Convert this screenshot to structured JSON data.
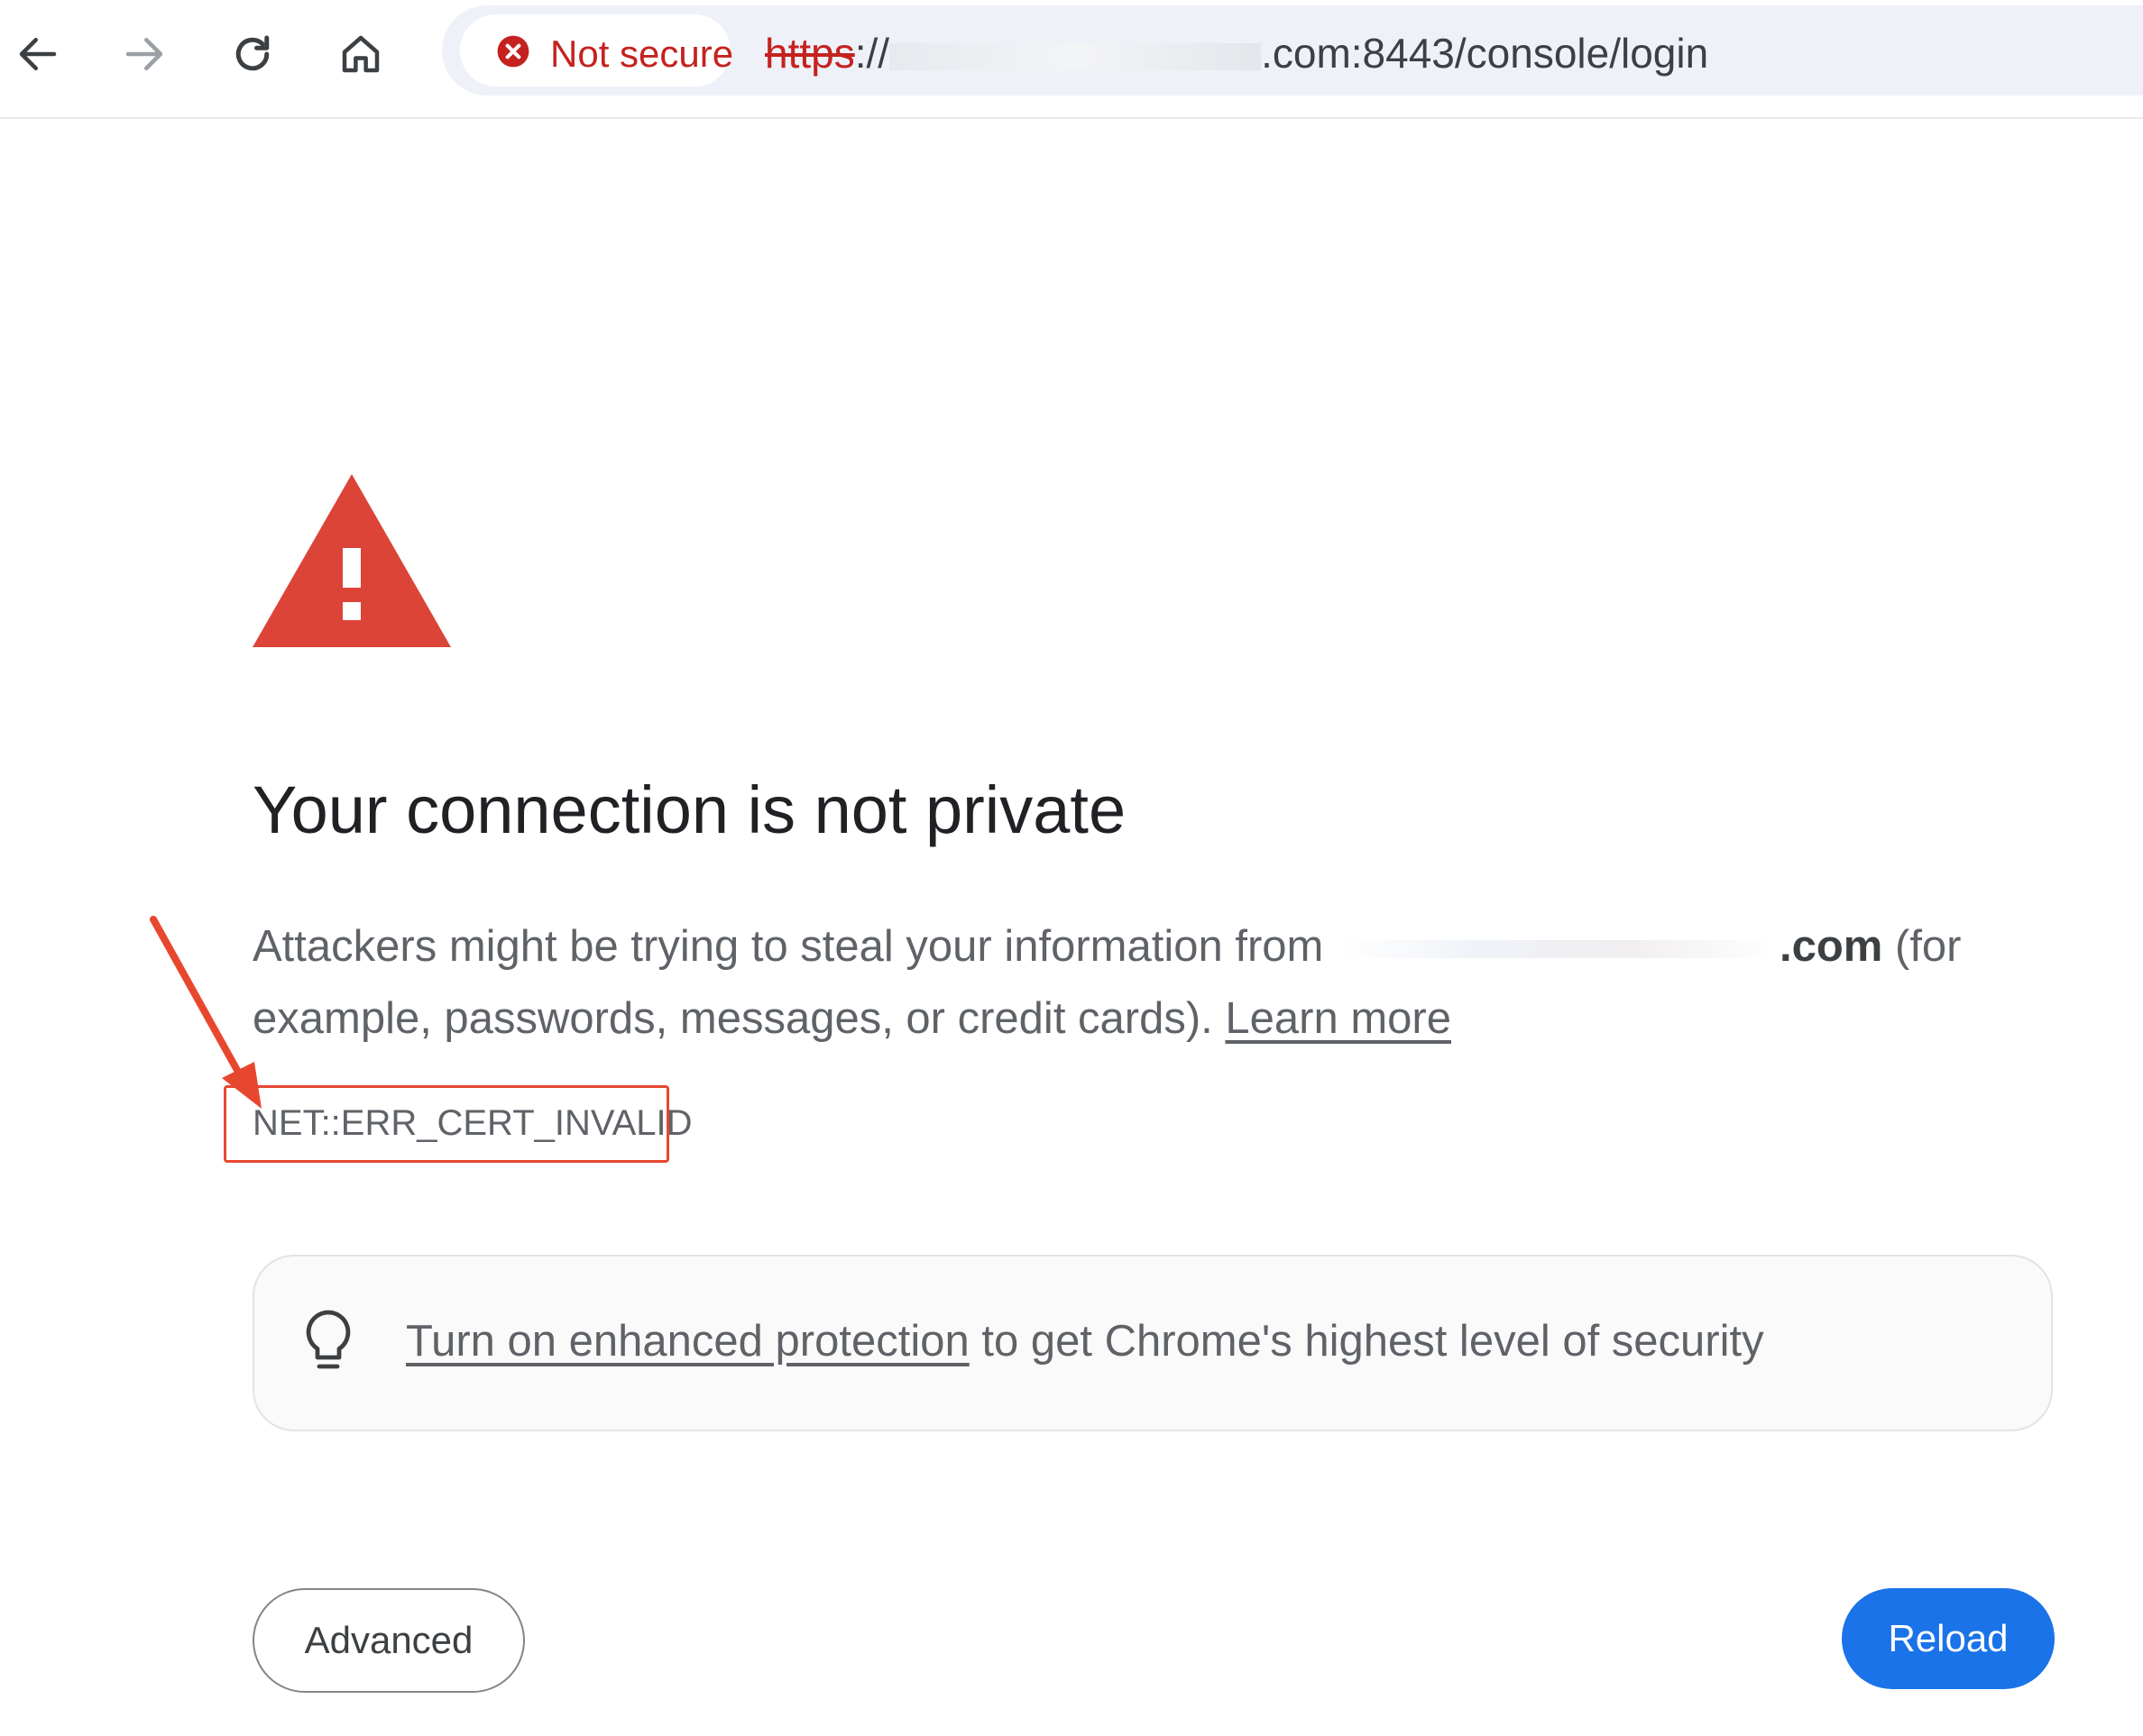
{
  "toolbar": {
    "back_icon": "arrow-left-icon",
    "forward_icon": "arrow-right-icon",
    "reload_icon": "reload-icon",
    "home_icon": "home-icon",
    "security_chip": {
      "icon": "error-circle-icon",
      "label": "Not secure",
      "color": "#c5221f"
    },
    "url": {
      "scheme": "https",
      "separator": "://",
      "suffix": ".com:8443/console/login"
    }
  },
  "interstitial": {
    "warning_icon": "warning-triangle-icon",
    "warning_color": "#db4437",
    "heading": "Your connection is not private",
    "body_prefix": "Attackers might be trying to steal your information from",
    "body_domain": ".com",
    "body_suffix": "(for example, passwords, messages, or credit cards).",
    "learn_more": "Learn more",
    "error_code": "NET::ERR_CERT_INVALID",
    "promo": {
      "icon": "lightbulb-icon",
      "link": "Turn on enhanced protection",
      "text": "to get Chrome's highest level of security"
    },
    "advanced_button": "Advanced",
    "reload_button": "Reload",
    "accent_color": "#1a73e8"
  },
  "annotation": {
    "highlight_color": "#e8472f",
    "arrow_icon": "red-arrow-icon"
  }
}
